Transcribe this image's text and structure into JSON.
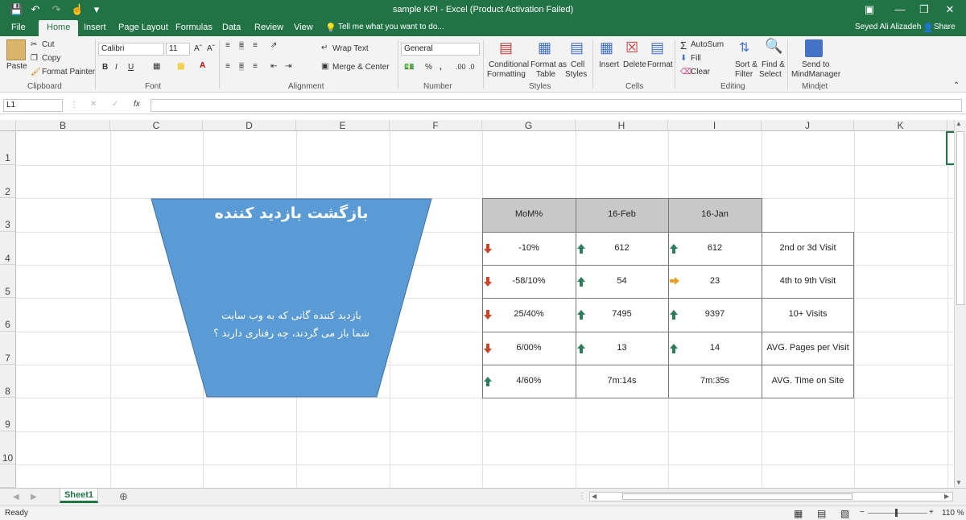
{
  "window": {
    "title": "sample KPI - Excel (Product Activation Failed)",
    "user": "Seyed Ali Alizadeh",
    "share": "Share"
  },
  "tabs": [
    "File",
    "Home",
    "Insert",
    "Page Layout",
    "Formulas",
    "Data",
    "Review",
    "View"
  ],
  "tell_me": "Tell me what you want to do...",
  "ribbon": {
    "paste": "Paste",
    "cut": "Cut",
    "copy": "Copy",
    "format_painter": "Format Painter",
    "clipboard": "Clipboard",
    "font_name": "Calibri",
    "font_size": "11",
    "font": "Font",
    "bold": "B",
    "italic": "I",
    "underline": "U",
    "grow": "Aˆ",
    "shrink": "Aˇ",
    "wrap_text": "Wrap Text",
    "merge_center": "Merge & Center",
    "alignment": "Alignment",
    "number_format": "General",
    "percent": "%",
    "comma": ",",
    "number": "Number",
    "conditional": "Conditional",
    "formatting": "Formatting",
    "format_as": "Format as",
    "table": "Table",
    "cell": "Cell",
    "styles_lbl": "Styles",
    "styles": "Styles",
    "insert": "Insert",
    "delete": "Delete",
    "format": "Format",
    "cells": "Cells",
    "autosum": "AutoSum",
    "fill": "Fill",
    "clear": "Clear",
    "sort_filter1": "Sort &",
    "sort_filter2": "Filter",
    "find_select1": "Find &",
    "find_select2": "Select",
    "editing": "Editing",
    "send_to": "Send to",
    "mindmanager": "MindManager",
    "mindjet": "Mindjet"
  },
  "formula_bar": {
    "name_box": "L1",
    "fx": "fx",
    "value": ""
  },
  "columns": [
    "B",
    "C",
    "D",
    "E",
    "F",
    "G",
    "H",
    "I",
    "J",
    "K"
  ],
  "rows": [
    "1",
    "2",
    "3",
    "4",
    "5",
    "6",
    "7",
    "8",
    "9",
    "10"
  ],
  "funnel": {
    "title": "بازگشت بازدید کننده",
    "line1": "بازدید کننده گانی که به وب سایت",
    "line2": "شما باز می گردند، چه رفتاری دارند ؟",
    "color": "#5b9bd5"
  },
  "kpi_table": {
    "headers": [
      "MoM%",
      "16-Feb",
      "16-Jan",
      ""
    ],
    "header_color": "#c8c8c8",
    "rows": [
      {
        "mom": "-10%",
        "mom_dir": "down",
        "feb": "612",
        "feb_dir": "up",
        "jan": "612",
        "jan_dir": "up",
        "label": "2nd or 3d Visit"
      },
      {
        "mom": "-58/10%",
        "mom_dir": "down",
        "feb": "54",
        "feb_dir": "up",
        "jan": "23",
        "jan_dir": "right",
        "label": "4th to 9th Visit"
      },
      {
        "mom": "25/40%",
        "mom_dir": "down",
        "feb": "7495",
        "feb_dir": "up",
        "jan": "9397",
        "jan_dir": "up",
        "label": "10+ Visits"
      },
      {
        "mom": "6/00%",
        "mom_dir": "down",
        "feb": "13",
        "feb_dir": "up",
        "jan": "14",
        "jan_dir": "up",
        "label": "AVG. Pages per Visit"
      },
      {
        "mom": "4/60%",
        "mom_dir": "up",
        "feb": "7m:14s",
        "feb_dir": "",
        "jan": "7m:35s",
        "jan_dir": "",
        "label": "AVG. Time on Site"
      }
    ],
    "arrow_colors": {
      "up": "#2e7d5b",
      "down": "#c8462a",
      "right": "#e8a020"
    }
  },
  "sheet_tab": "Sheet1",
  "status": {
    "ready": "Ready",
    "zoom": "110 %"
  }
}
